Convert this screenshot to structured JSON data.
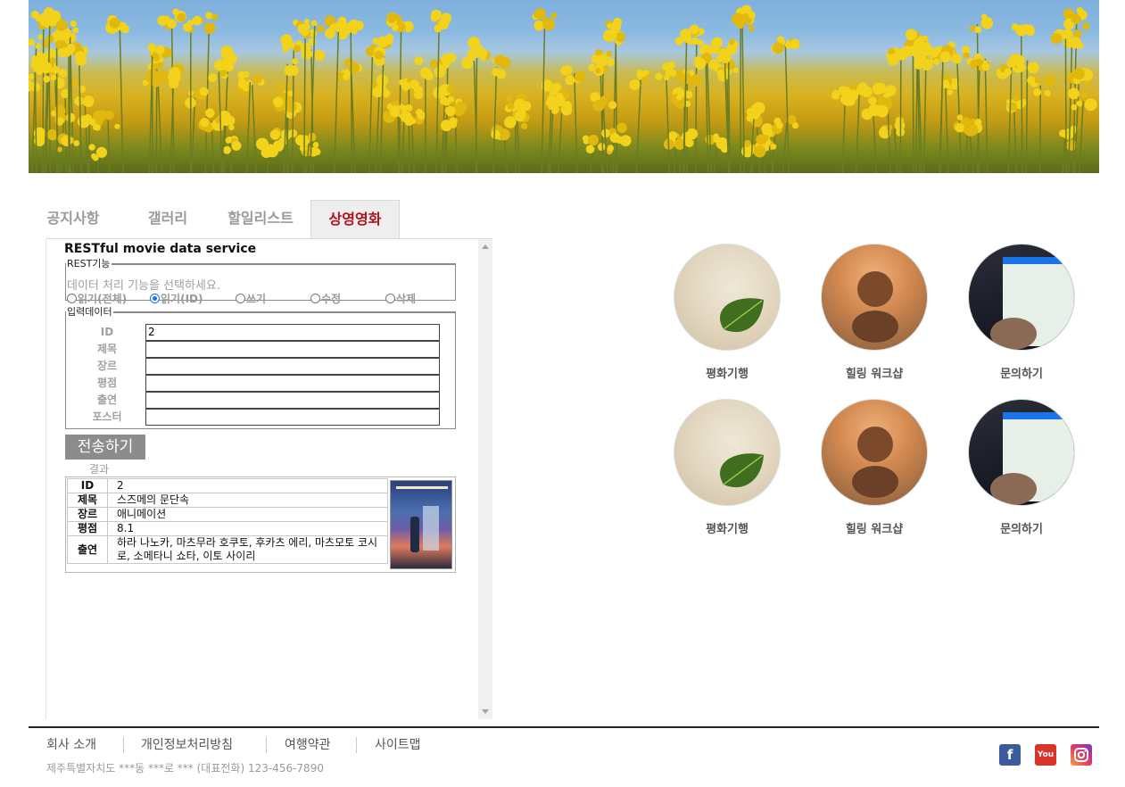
{
  "tabs": [
    {
      "label": "공지사항",
      "active": false
    },
    {
      "label": "갤러리",
      "active": false
    },
    {
      "label": "할일리스트",
      "active": false
    },
    {
      "label": "상영영화",
      "active": true
    }
  ],
  "service": {
    "title": "RESTful movie data service",
    "rest_legend": "REST기능",
    "rest_hint": "데이터 처리 기능을 선택하세요.",
    "radios": [
      {
        "label": "읽기(전체)",
        "checked": false
      },
      {
        "label": "읽기(ID)",
        "checked": true
      },
      {
        "label": "쓰기",
        "checked": false
      },
      {
        "label": "수정",
        "checked": false
      },
      {
        "label": "삭제",
        "checked": false
      }
    ],
    "input_legend": "입력데이터",
    "fields": [
      {
        "label": "ID",
        "value": "2"
      },
      {
        "label": "제목",
        "value": ""
      },
      {
        "label": "장르",
        "value": ""
      },
      {
        "label": "평점",
        "value": ""
      },
      {
        "label": "출연",
        "value": ""
      },
      {
        "label": "포스터",
        "value": ""
      }
    ],
    "submit_label": "전송하기",
    "result_label": "결과",
    "result_rows": [
      {
        "key": "ID",
        "value": "2"
      },
      {
        "key": "제목",
        "value": "스즈메의 문단속"
      },
      {
        "key": "장르",
        "value": "애니메이션"
      },
      {
        "key": "평점",
        "value": "8.1"
      },
      {
        "key": "출연",
        "value": "하라 나노카, 마츠무라 호쿠토, 후카츠 에리, 마츠모토 코시로, 소메타니 쇼타, 이토 사이리"
      }
    ]
  },
  "circles": [
    {
      "label": "평화기행",
      "icon": "leaf-on-sand-image"
    },
    {
      "label": "힐링 워크샵",
      "icon": "stacked-stones-image"
    },
    {
      "label": "문의하기",
      "icon": "phone-keypad-image"
    },
    {
      "label": "평화기행",
      "icon": "leaf-on-sand-image"
    },
    {
      "label": "힐링 워크샵",
      "icon": "stacked-stones-image"
    },
    {
      "label": "문의하기",
      "icon": "phone-keypad-image"
    }
  ],
  "footer": {
    "links": [
      "회사 소개",
      "개인정보처리방침",
      "여행약관",
      "사이트맵"
    ],
    "address": "제주특별자치도 ***동 ***로 *** (대표전화) 123-456-7890",
    "sns": [
      {
        "name": "facebook-icon",
        "glyph": "f"
      },
      {
        "name": "youtube-icon",
        "glyph": "You Tube"
      },
      {
        "name": "instagram-icon",
        "glyph": ""
      }
    ]
  },
  "colors": {
    "active_tab": "#b3121d",
    "submit_bg": "#8c8c8c",
    "radio_accent": "#1a73e8"
  }
}
